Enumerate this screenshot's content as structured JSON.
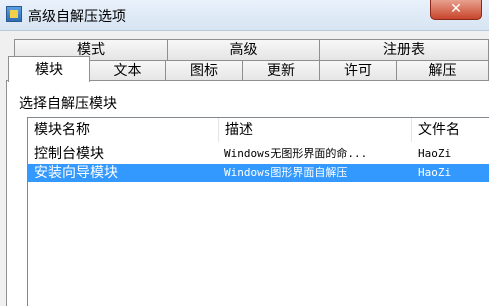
{
  "window": {
    "title": "高级自解压选项",
    "close": "✕"
  },
  "tabs": {
    "row_top": [
      "模式",
      "高级",
      "注册表"
    ],
    "row_bottom": [
      "模块",
      "文本",
      "图标",
      "更新",
      "许可",
      "解压"
    ],
    "active": "模块"
  },
  "modules": {
    "section_label": "选择自解压模块",
    "columns": [
      "模块名称",
      "描述",
      "文件名"
    ],
    "rows": [
      {
        "name": "控制台模块",
        "desc": "Windows无图形界面的命...",
        "file": "HaoZi",
        "selected": false
      },
      {
        "name": "安装向导模块",
        "desc": "Windows图形界面自解压",
        "file": "HaoZi",
        "selected": true
      }
    ]
  }
}
